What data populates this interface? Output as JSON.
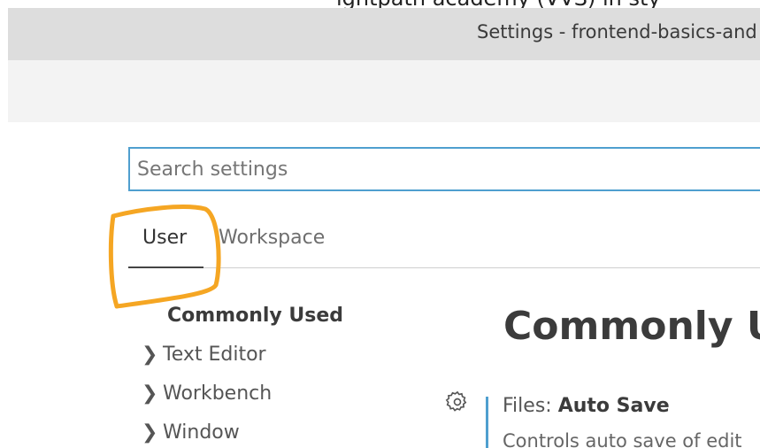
{
  "top_crop_text": "ightpath academy (VVS) in sty",
  "window": {
    "title": "Settings - frontend-basics-and"
  },
  "search": {
    "placeholder": "Search settings",
    "value": ""
  },
  "tabs": [
    {
      "label": "User",
      "active": true
    },
    {
      "label": "Workspace",
      "active": false
    }
  ],
  "toc": {
    "selected": "Commonly Used",
    "items": [
      {
        "label": "Text Editor",
        "icon": "chevron-right-icon"
      },
      {
        "label": "Workbench",
        "icon": "chevron-right-icon"
      },
      {
        "label": "Window",
        "icon": "chevron-right-icon"
      }
    ]
  },
  "main": {
    "heading": "Commonly U",
    "setting": {
      "category": "Files: ",
      "name": "Auto Save",
      "description": "Controls auto save of edit",
      "icon": "gear-icon"
    }
  },
  "colors": {
    "titlebar": "#dddddd",
    "accent": "#4f9fcf",
    "annotation": "#f5a623"
  }
}
